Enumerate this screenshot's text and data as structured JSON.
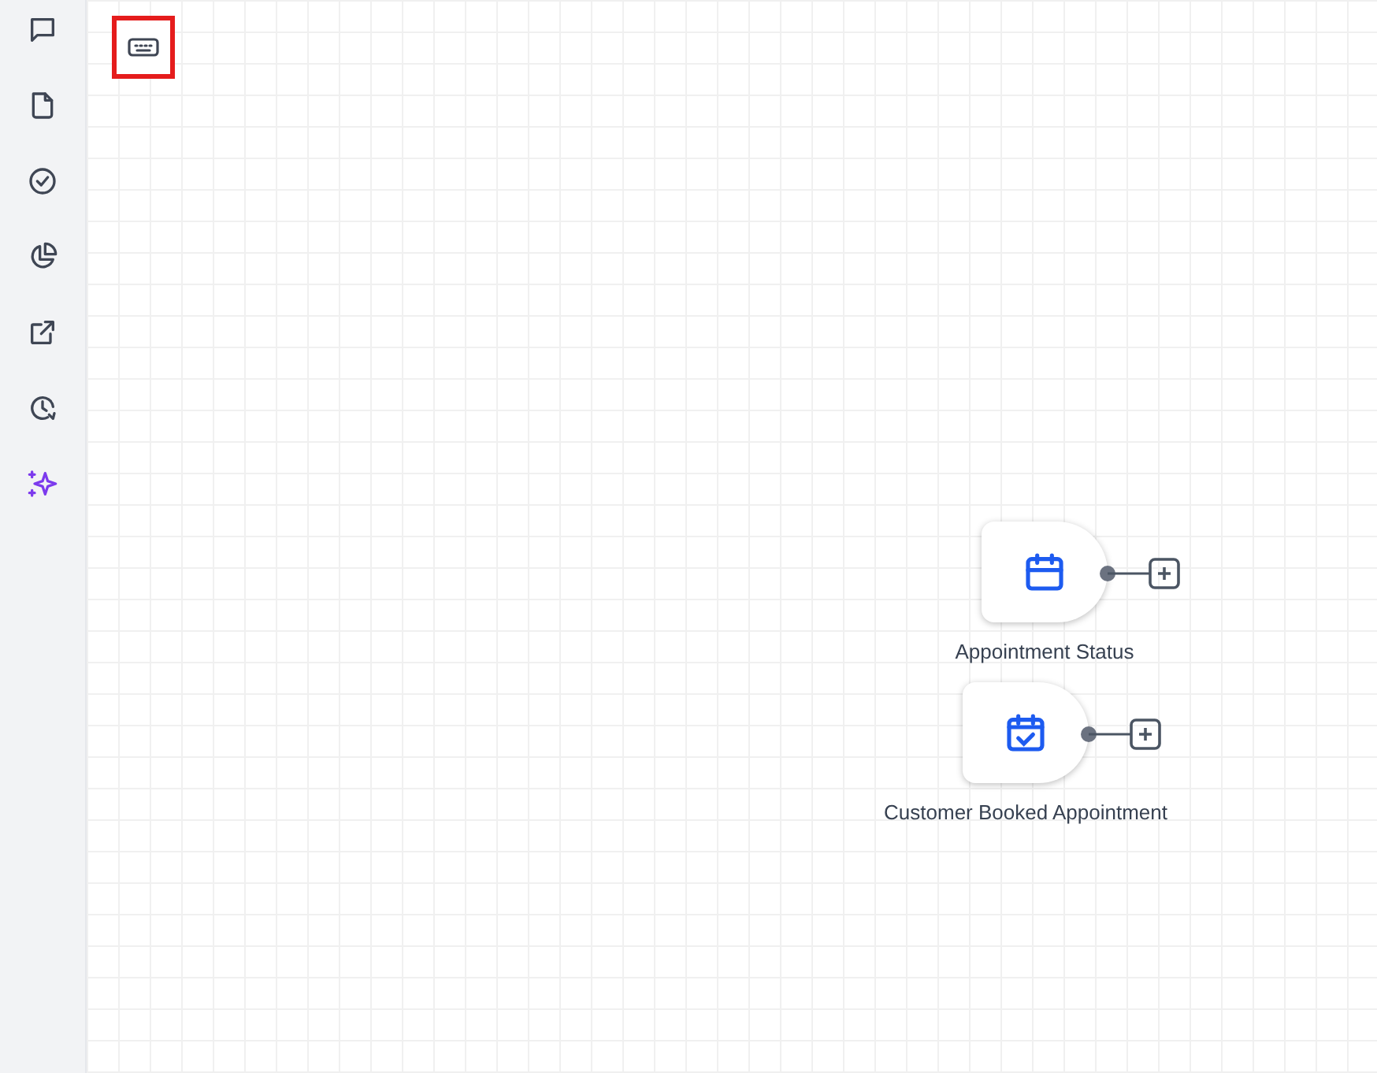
{
  "sidebar": {
    "items": [
      {
        "kind": "chat"
      },
      {
        "kind": "document"
      },
      {
        "kind": "check"
      },
      {
        "kind": "pie"
      },
      {
        "kind": "external"
      },
      {
        "kind": "history"
      },
      {
        "kind": "sparkle"
      }
    ]
  },
  "toolbar": {
    "keyboard_highlighted": true
  },
  "nodes": [
    {
      "kind": "calendar",
      "label": "Appointment Status"
    },
    {
      "kind": "calendar-check",
      "label": "Customer Booked Appointment"
    }
  ]
}
